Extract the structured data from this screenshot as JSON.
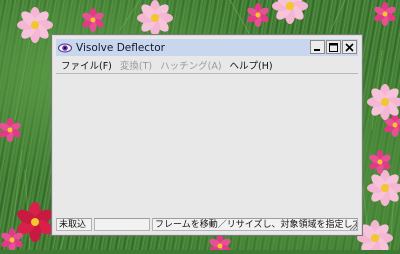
{
  "window": {
    "title": "Visolve Deflector",
    "controls": {
      "minimize_icon": "minimize-icon",
      "maximize_icon": "maximize-icon",
      "close_icon": "close-icon"
    }
  },
  "menu": {
    "items": [
      {
        "label": "ファイル(F)",
        "enabled": true
      },
      {
        "label": "変換(T)",
        "enabled": false
      },
      {
        "label": "ハッチング(A)",
        "enabled": false
      },
      {
        "label": "ヘルプ(H)",
        "enabled": true
      }
    ]
  },
  "statusbar": {
    "status": "未取込",
    "secondary": "",
    "message": "フレームを移動／リサイズし、対象領域を指定して"
  },
  "colors": {
    "titlebar": "#c9d7ee",
    "window_frame": "#e8e8e8",
    "flower_pink": "#f7b3d2",
    "flower_magenta": "#e23a86",
    "flower_red": "#d8204a",
    "flower_center": "#f3c62a"
  }
}
